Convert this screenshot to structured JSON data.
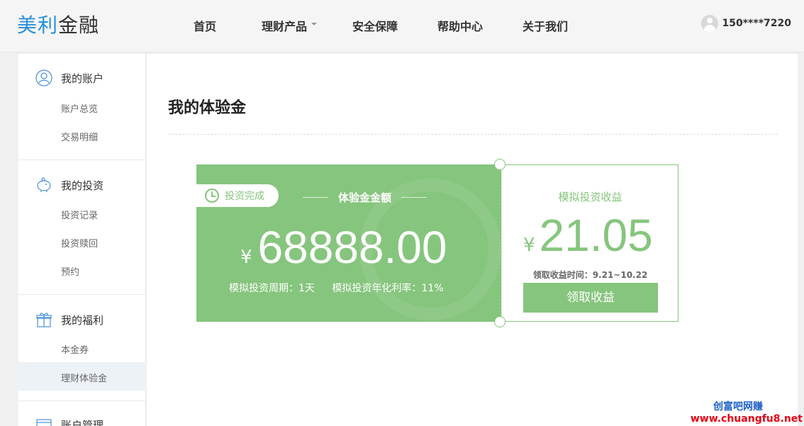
{
  "header": {
    "logo_part1": "美利",
    "logo_part2": "金融",
    "nav": [
      {
        "label": "首页"
      },
      {
        "label": "理财产品"
      },
      {
        "label": "安全保障"
      },
      {
        "label": "帮助中心"
      },
      {
        "label": "关于我们"
      }
    ],
    "user_phone": "150****7220"
  },
  "sidebar": {
    "groups": [
      {
        "title": "我的账户",
        "icon": "user-icon",
        "items": [
          "账户总览",
          "交易明细"
        ]
      },
      {
        "title": "我的投资",
        "icon": "piggy-bank-icon",
        "items": [
          "投资记录",
          "投资赎回",
          "预约"
        ]
      },
      {
        "title": "我的福利",
        "icon": "gift-icon",
        "items": [
          "本金券",
          "理财体验金"
        ]
      },
      {
        "title": "账户管理",
        "icon": "card-icon",
        "items": []
      }
    ],
    "active_item": "理财体验金"
  },
  "main": {
    "title": "我的体验金",
    "card": {
      "status": "投资完成",
      "amount_label": "体验金金额",
      "currency": "¥",
      "amount": "68888.00",
      "period": "模拟投资周期：1天",
      "rate": "模拟投资年化利率：11%"
    },
    "earnings": {
      "label": "模拟投资收益",
      "currency": "¥",
      "amount": "21.05",
      "time": "领取收益时间：9.21~10.22",
      "button": "领取收益"
    }
  },
  "watermark": {
    "line1": "创富吧网赚",
    "line2": "www.chuangfu8.net"
  },
  "colors": {
    "accent_green": "#86c57d",
    "logo_blue": "#2a8fd6"
  }
}
